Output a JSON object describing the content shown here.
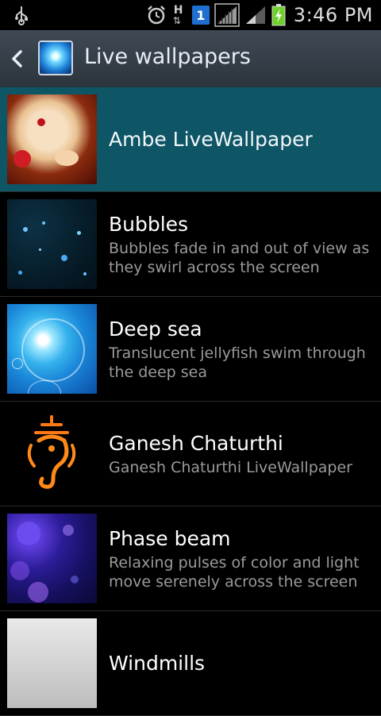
{
  "status_bar": {
    "time": "3:46 PM",
    "network_label": "H",
    "sim_badge": "1",
    "icons": [
      "usb-icon",
      "alarm-icon",
      "data-arrows-icon",
      "sim-icon",
      "signal-icon",
      "signal-icon-2",
      "battery-charging-icon"
    ]
  },
  "action_bar": {
    "title": "Live wallpapers",
    "back_icon": "back-arrow-icon",
    "app_icon": "live-wallpaper-app-icon"
  },
  "wallpapers": [
    {
      "name": "Ambe LiveWallpaper",
      "description": "",
      "selected": true
    },
    {
      "name": "Bubbles",
      "description": "Bubbles fade in and out of view as they swirl across the screen",
      "selected": false
    },
    {
      "name": "Deep sea",
      "description": "Translucent jellyfish swim through the deep sea",
      "selected": false
    },
    {
      "name": "Ganesh Chaturthi",
      "description": "Ganesh Chaturthi LiveWallpaper",
      "selected": false
    },
    {
      "name": "Phase beam",
      "description": "Relaxing pulses of color and light move serenely across the screen",
      "selected": false
    },
    {
      "name": "Windmills",
      "description": "",
      "selected": false
    }
  ],
  "colors": {
    "selected_row": "#0e5565",
    "action_bar": "#37414a",
    "description_text": "#9a9a9a"
  }
}
